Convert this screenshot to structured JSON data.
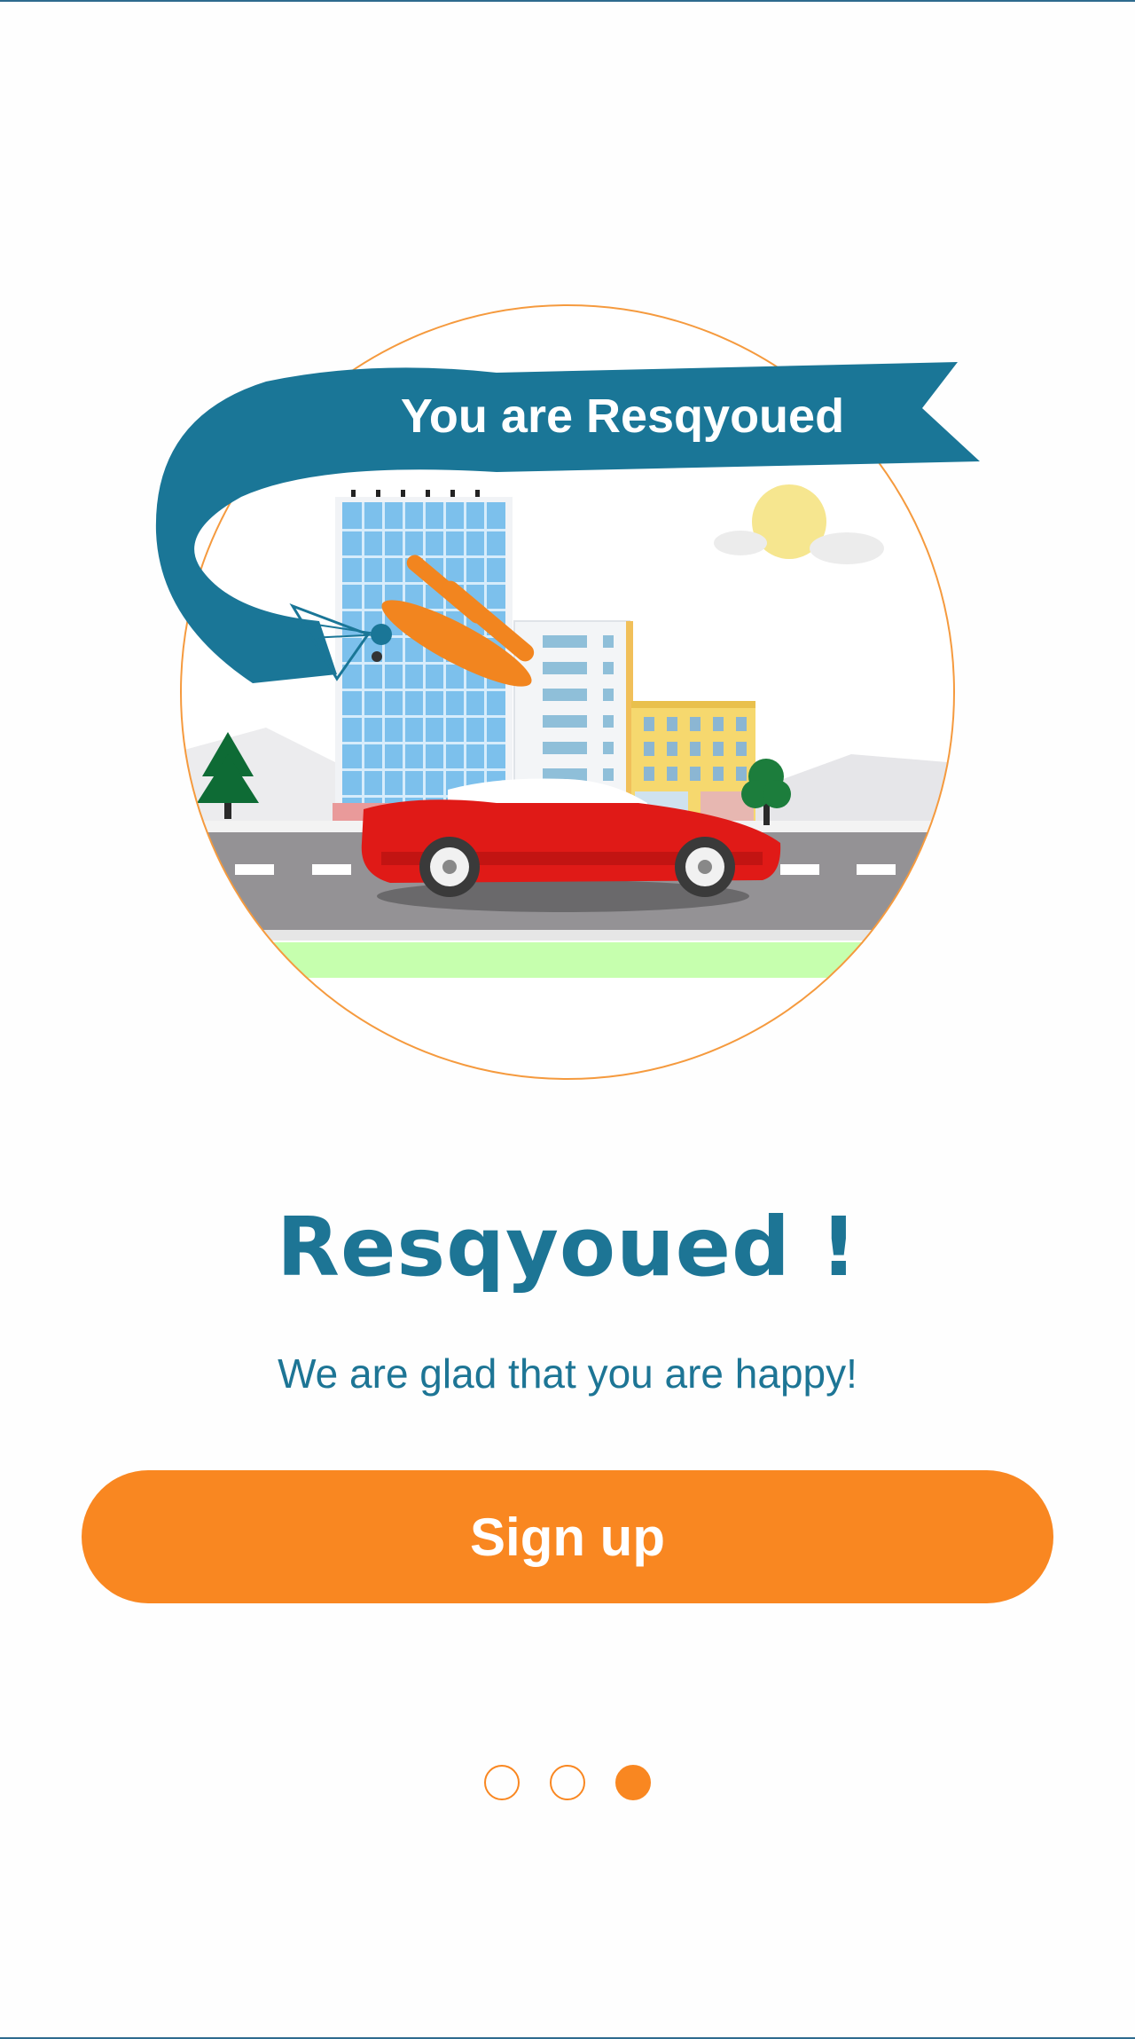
{
  "hero": {
    "banner_text": "You are Resqyoued"
  },
  "title": "Resqyoued !",
  "subtitle": "We are glad that you are happy!",
  "signup_label": "Sign up",
  "pager": {
    "count": 3,
    "active_index": 2
  },
  "colors": {
    "accent": "#f98721",
    "brand": "#1d7595"
  }
}
